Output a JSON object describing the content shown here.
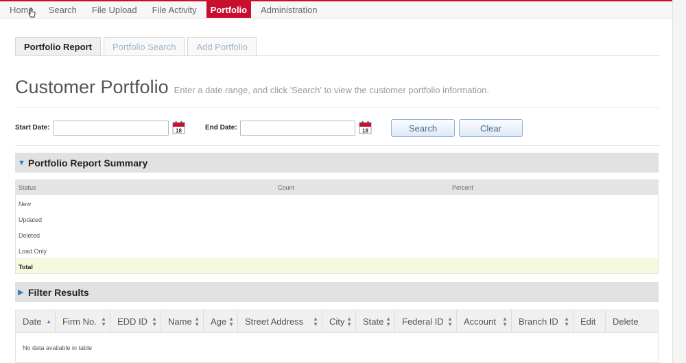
{
  "nav": {
    "items": [
      "Home",
      "Search",
      "File Upload",
      "File Activity",
      "Portfolio",
      "Administration"
    ],
    "active": "Portfolio"
  },
  "tabs": [
    {
      "label": "Portfolio Report",
      "active": true
    },
    {
      "label": "Portfolio Search",
      "active": false
    },
    {
      "label": "Add Portfolio",
      "active": false
    }
  ],
  "heading": {
    "title": "Customer Portfolio",
    "subtitle": "Enter a date range, and click 'Search' to view the customer portfolio information."
  },
  "dates": {
    "start_label": "Start Date:",
    "start_value": "",
    "end_label": "End Date:",
    "end_value": "",
    "calendar_day": "18",
    "search_label": "Search",
    "clear_label": "Clear"
  },
  "summary": {
    "title": "Portfolio Report Summary",
    "columns": [
      "Status",
      "Count",
      "Percent"
    ],
    "rows": [
      "New",
      "Updated",
      "Deleted",
      "Load Only"
    ],
    "total_label": "Total"
  },
  "filter": {
    "title": "Filter Results",
    "columns": [
      "Date",
      "Firm No.",
      "EDD ID",
      "Name",
      "Age",
      "Street Address",
      "City",
      "State",
      "Federal ID",
      "Account",
      "Branch ID",
      "Edit",
      "Delete"
    ],
    "empty_text": "No data available in table"
  },
  "colors": {
    "brand": "#c8102e",
    "accent": "#2f7fc6",
    "total_row": "#f5fadf"
  }
}
